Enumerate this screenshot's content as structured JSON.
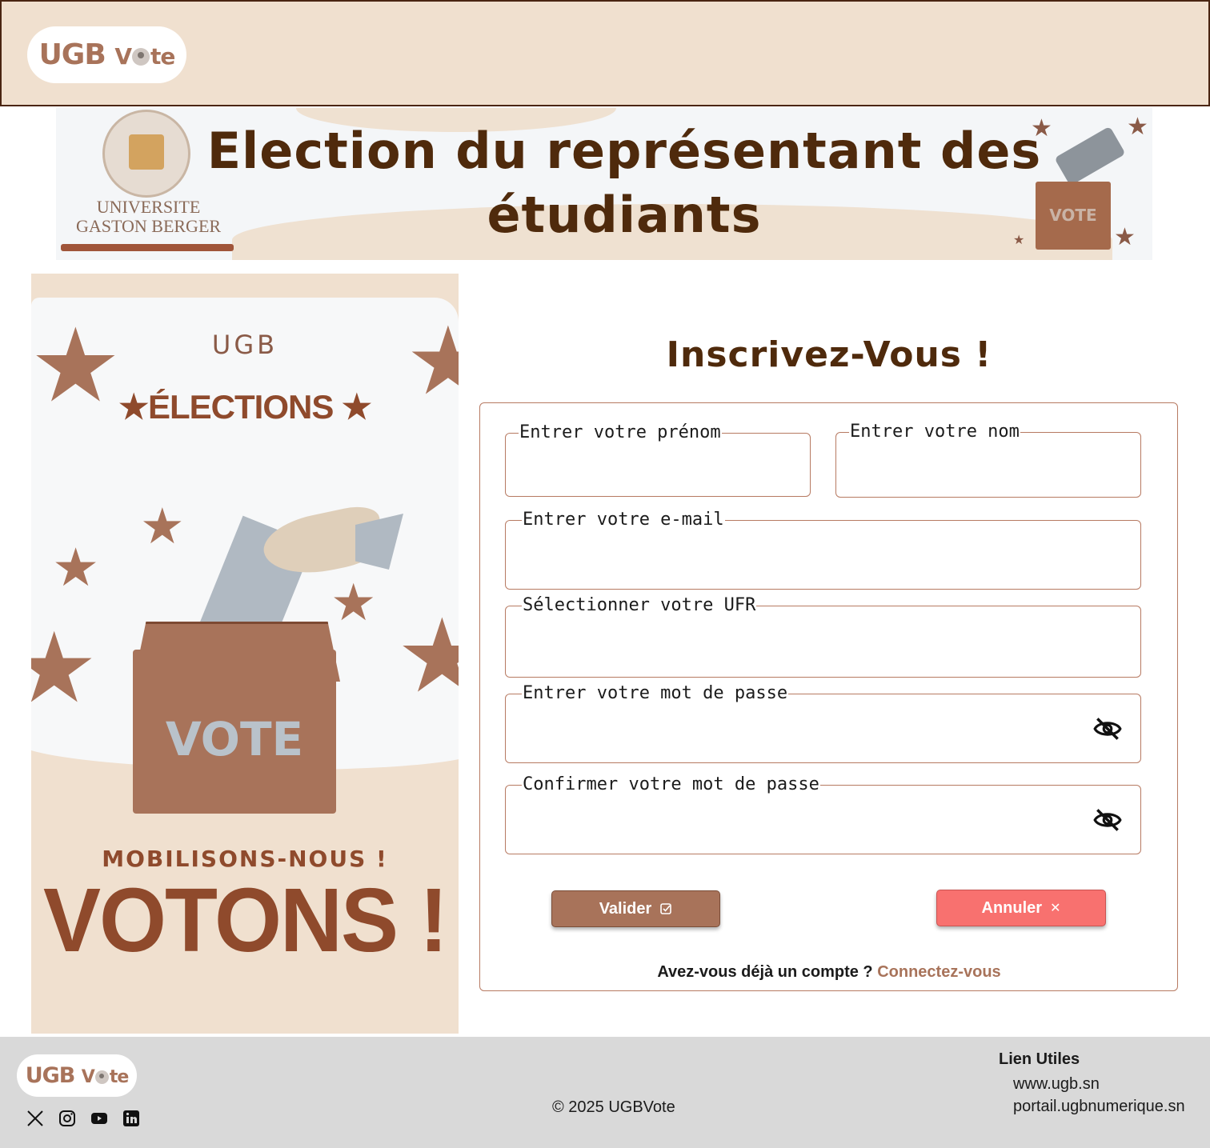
{
  "header": {
    "logo": {
      "part1": "UGB",
      "part2a": "V",
      "part2b": "te"
    }
  },
  "banner": {
    "university": [
      "UNIVERSITE",
      "GASTON BERGER"
    ],
    "title": "Election du représentant des étudiants",
    "ballot_label": "VOTE"
  },
  "poster": {
    "ugb": "UGB",
    "elections": "★ÉLECTIONS ★",
    "ballot_label": "VOTE",
    "mobilisons": "MOBILISONS-NOUS !",
    "votons": "VOTONS !"
  },
  "form": {
    "title": "Inscrivez-Vous !",
    "fields": {
      "prenom": {
        "label": "Entrer votre prénom",
        "value": ""
      },
      "nom": {
        "label": "Entrer votre nom",
        "value": ""
      },
      "email": {
        "label": "Entrer votre e-mail",
        "value": ""
      },
      "ufr": {
        "label": "Sélectionner votre UFR",
        "value": ""
      },
      "password": {
        "label": "Entrer votre mot de passe",
        "value": ""
      },
      "confirm": {
        "label": "Confirmer votre mot de passe",
        "value": ""
      }
    },
    "buttons": {
      "valider": "Valider",
      "annuler": "Annuler"
    },
    "account_question": "Avez-vous déjà un compte ?",
    "login_link": "Connectez-vous"
  },
  "footer": {
    "logo": {
      "part1": "UGB",
      "part2a": "V",
      "part2b": "te"
    },
    "socials": [
      "x-icon",
      "instagram-icon",
      "youtube-icon",
      "linkedin-icon"
    ],
    "copyright": "© 2025 UGBVote",
    "links_title": "Lien Utiles",
    "links": [
      "www.ugb.sn",
      "portail.ugbnumerique.sn"
    ]
  },
  "colors": {
    "brand": "#a8735a",
    "title": "#4f2a0c",
    "header_bg": "#f0e0cf",
    "cancel": "#f8716f",
    "footer_bg": "#d9d9d9"
  }
}
